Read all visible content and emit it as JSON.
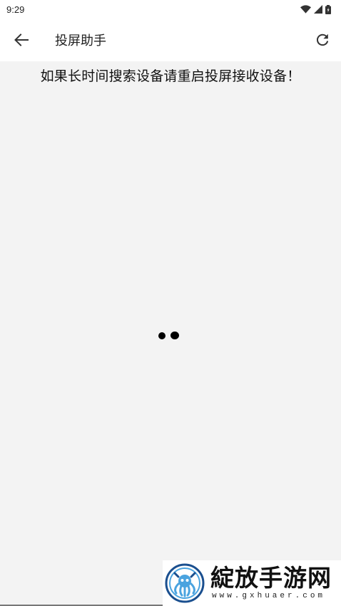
{
  "status_bar": {
    "time": "9:29",
    "icons": [
      "wifi-icon",
      "signal-icon",
      "battery-icon"
    ]
  },
  "app_bar": {
    "back_icon": "arrow-left-icon",
    "title": "投屏助手",
    "refresh_icon": "refresh-icon"
  },
  "content": {
    "hint": "如果长时间搜索设备请重启投屏接收设备！",
    "loading_indicator": "loading-dots"
  },
  "watermark": {
    "brand": "綻放手游网",
    "url": "www.gxhuaer.com"
  },
  "colors": {
    "app_bar_bg": "#ffffff",
    "content_bg": "#f3f3f3",
    "text": "#111111",
    "logo_blue": "#1a6fc4"
  }
}
